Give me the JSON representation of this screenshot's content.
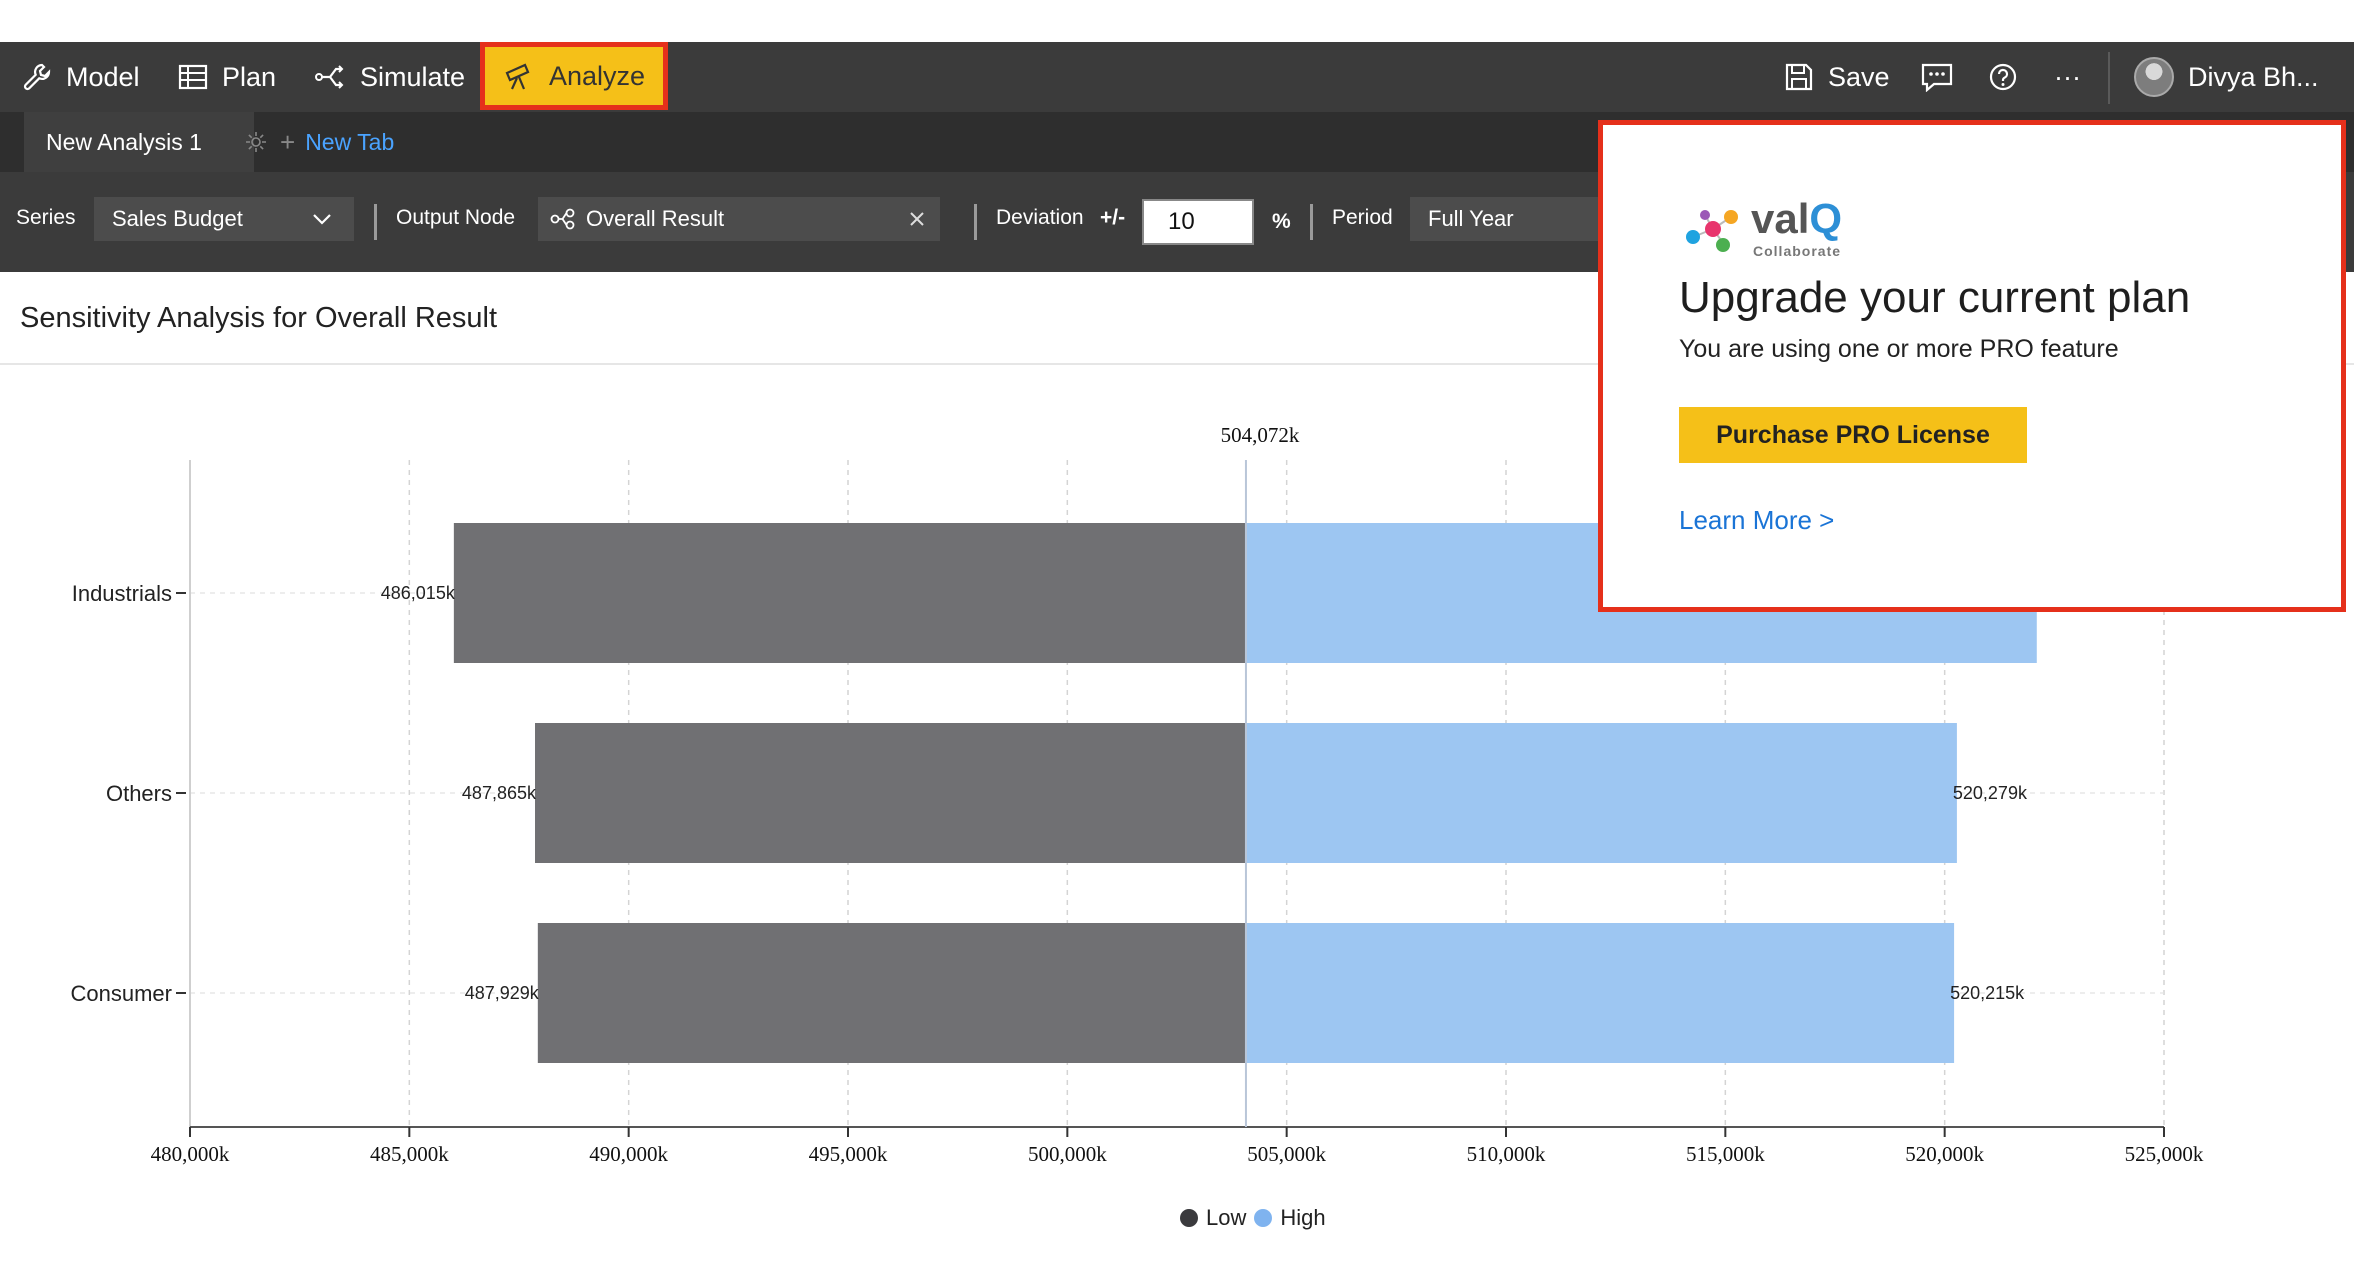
{
  "nav": {
    "model": "Model",
    "plan": "Plan",
    "simulate": "Simulate",
    "analyze": "Analyze",
    "save": "Save",
    "more": "···",
    "user": "Divya Bh..."
  },
  "tabs": {
    "active": "New Analysis 1",
    "new": "New Tab"
  },
  "filters": {
    "series_label": "Series",
    "series_value": "Sales Budget",
    "output_label": "Output Node",
    "output_value": "Overall Result",
    "deviation_label": "Deviation",
    "deviation_pm": "+/-",
    "deviation_value": "10",
    "deviation_unit": "%",
    "period_label": "Period",
    "period_value": "Full Year"
  },
  "title": "Sensitivity Analysis for Overall Result",
  "popup": {
    "logo_val": "val",
    "logo_q": "Q",
    "logo_sub": "Collaborate",
    "title": "Upgrade your current plan",
    "subtitle": "You are using one or more PRO feature",
    "button": "Purchase PRO License",
    "link": "Learn More >"
  },
  "legend": {
    "low": "Low",
    "high": "High"
  },
  "colors": {
    "low": "#707073",
    "high": "#9dc6f2",
    "accent": "#f5c018",
    "highlight": "#e5301b"
  },
  "chart_data": {
    "type": "bar",
    "orientation": "horizontal-tornado",
    "base_value": 504072,
    "base_label": "504,072k",
    "categories": [
      "Industrials",
      "Others",
      "Consumer"
    ],
    "series": [
      {
        "name": "Low",
        "values": [
          486015,
          487865,
          487929
        ],
        "labels": [
          "486,015k",
          "487,865k",
          "487,929k"
        ]
      },
      {
        "name": "High",
        "values": [
          522100,
          520279,
          520215
        ],
        "labels": [
          "",
          "520,279k",
          "520,215k"
        ]
      }
    ],
    "xlim": [
      480000,
      525000
    ],
    "xticks": [
      480000,
      485000,
      490000,
      495000,
      500000,
      505000,
      510000,
      515000,
      520000,
      525000
    ],
    "xtick_labels": [
      "480,000k",
      "485,000k",
      "490,000k",
      "495,000k",
      "500,000k",
      "505,000k",
      "510,000k",
      "515,000k",
      "520,000k",
      "525,000k"
    ],
    "grid": true,
    "legend": "bottom"
  }
}
